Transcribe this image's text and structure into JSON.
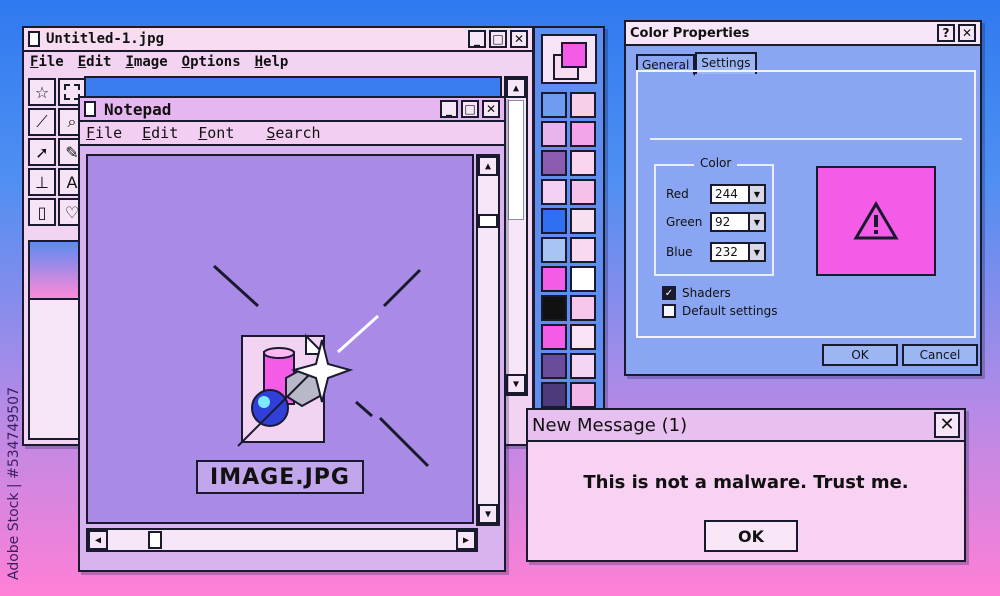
{
  "paint": {
    "title": "Untitled-1.jpg",
    "menu": [
      "File",
      "Edit",
      "Image",
      "Options",
      "Help"
    ],
    "tools": [
      "star-icon",
      "marquee-icon",
      "eyedropper-icon",
      "magnifier-icon",
      "pointer-icon",
      "pen-icon",
      "brush-icon",
      "text-icon",
      "spray-icon",
      "heart-icon"
    ],
    "tool_text_A": "A"
  },
  "palette": {
    "fg": "#f45ce8",
    "bg": "#f7dcf2",
    "colors": [
      "#6f9cf0",
      "#f7cfe8",
      "#e8b4ec",
      "#f2a6e8",
      "#8a5cb0",
      "#f9d6f0",
      "#f4d0f4",
      "#f6c0ec",
      "#2f6ff0",
      "#f7e0f0",
      "#a8c4f4",
      "#f9d8f2",
      "#f45ce8",
      "#ffffff",
      "#111111",
      "#f7c6ec",
      "#f45ce8",
      "#f9e2f6",
      "#6a4c9c",
      "#f4d6f4",
      "#4c3a7a",
      "#f2b6e8"
    ]
  },
  "notepad": {
    "title": "Notepad",
    "menu": [
      "File",
      "Edit",
      "Font",
      "Search"
    ],
    "file_label": "IMAGE.JPG"
  },
  "colorprops": {
    "title": "Color Properties",
    "tabs": [
      "General",
      "Settings"
    ],
    "group_title": "Color",
    "red_label": "Red",
    "red_value": "244",
    "green_label": "Green",
    "green_value": "92",
    "blue_label": "Blue",
    "blue_value": "232",
    "shaders_label": "Shaders",
    "default_label": "Default settings",
    "ok_label": "OK",
    "cancel_label": "Cancel",
    "preview_color": "#f45ce8"
  },
  "msgbox": {
    "title": "New Message (1)",
    "text": "This is not a malware. Trust me.",
    "ok_label": "OK"
  },
  "watermark": "Adobe Stock | #534749507"
}
